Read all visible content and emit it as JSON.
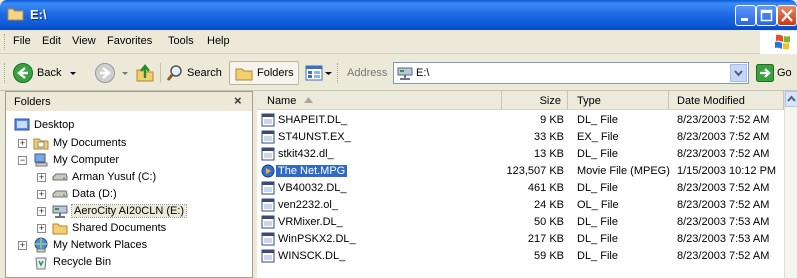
{
  "window": {
    "title": "E:\\"
  },
  "menu": [
    "File",
    "Edit",
    "View",
    "Favorites",
    "Tools",
    "Help"
  ],
  "toolbar": {
    "back_label": "Back",
    "search_label": "Search",
    "folders_label": "Folders",
    "address_label": "Address",
    "address_value": "E:\\",
    "go_label": "Go"
  },
  "folders_pane": {
    "title": "Folders",
    "close_glyph": "×",
    "tree": [
      {
        "label": "Desktop",
        "icon": "desktop-icon"
      },
      {
        "label": "My Documents",
        "icon": "folder-documents-icon"
      },
      {
        "label": "My Computer",
        "icon": "computer-icon"
      },
      {
        "label": "Arman Yusuf (C:)",
        "icon": "drive-icon"
      },
      {
        "label": "Data (D:)",
        "icon": "drive-icon"
      },
      {
        "label": "AeroCity AI20CLN (E:)",
        "icon": "network-drive-icon"
      },
      {
        "label": "Shared Documents",
        "icon": "folder-icon"
      },
      {
        "label": "My Network Places",
        "icon": "network-places-icon"
      },
      {
        "label": "Recycle Bin",
        "icon": "recycle-bin-icon"
      }
    ]
  },
  "file_list": {
    "columns": [
      "Name",
      "Size",
      "Type",
      "Date Modified"
    ],
    "rows": [
      {
        "name": "SHAPEIT.DL_",
        "size": "9 KB",
        "type": "DL_ File",
        "date": "8/23/2003 7:52 AM"
      },
      {
        "name": "ST4UNST.EX_",
        "size": "33 KB",
        "type": "EX_ File",
        "date": "8/23/2003 7:52 AM"
      },
      {
        "name": "stkit432.dl_",
        "size": "13 KB",
        "type": "DL_ File",
        "date": "8/23/2003 7:52 AM"
      },
      {
        "name": "The Net.MPG",
        "size": "123,507 KB",
        "type": "Movie File (MPEG)",
        "date": "1/15/2003 10:12 PM"
      },
      {
        "name": "VB40032.DL_",
        "size": "461 KB",
        "type": "DL_ File",
        "date": "8/23/2003 7:52 AM"
      },
      {
        "name": "ven2232.ol_",
        "size": "24 KB",
        "type": "OL_ File",
        "date": "8/23/2003 7:52 AM"
      },
      {
        "name": "VRMixer.DL_",
        "size": "50 KB",
        "type": "DL_ File",
        "date": "8/23/2003 7:53 AM"
      },
      {
        "name": "WinPSKX2.DL_",
        "size": "217 KB",
        "type": "DL_ File",
        "date": "8/23/2003 7:53 AM"
      },
      {
        "name": "WINSCK.DL_",
        "size": "59 KB",
        "type": "DL_ File",
        "date": "8/23/2003 7:52 AM"
      }
    ]
  }
}
